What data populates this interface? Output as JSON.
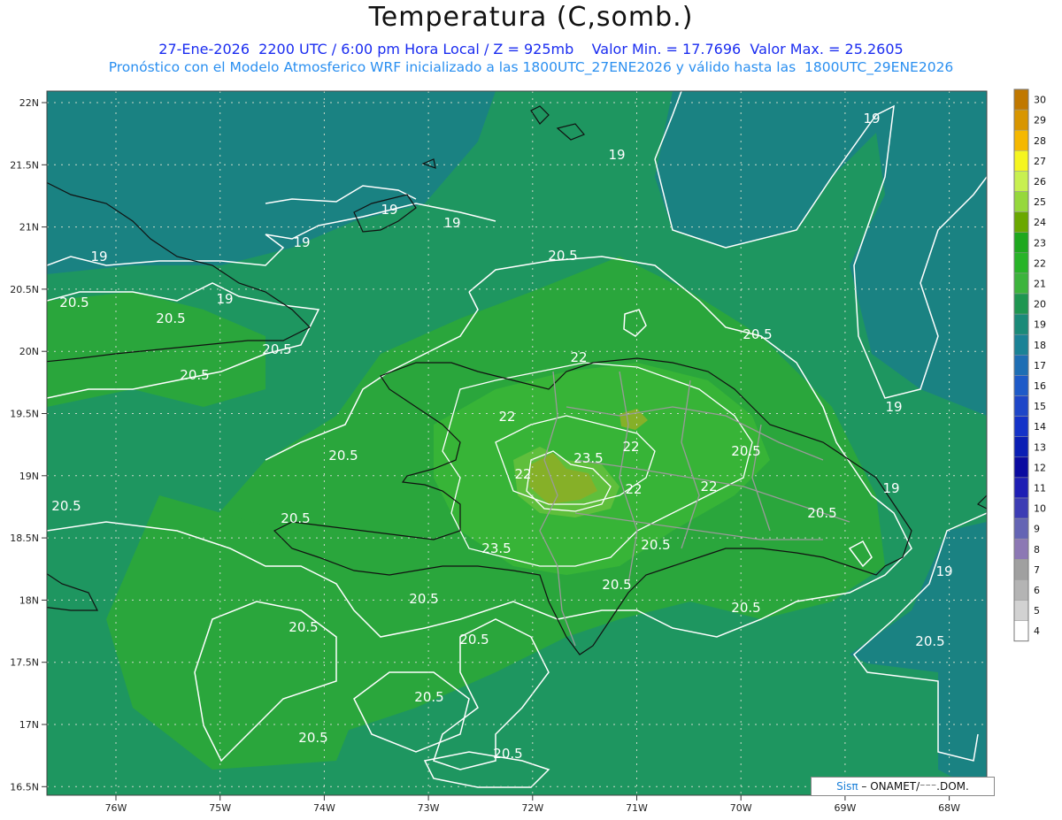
{
  "title": "Temperatura (C,somb.)",
  "subtitle_line1": "27-Ene-2026  2200 UTC / 6:00 pm Hora Local / Z = 925mb    Valor Min. = 17.7696  Valor Max. = 25.2605",
  "subtitle_line2": "Pronóstico con el Modelo Atmosferico WRF inicializado a las 1800UTC_27ENE2026 y válido hasta las  1800UTC_29ENE2026",
  "lat_labels": [
    "22N",
    "21.5N",
    "21N",
    "20.5N",
    "20N",
    "19.5N",
    "19N",
    "18.5N",
    "18N",
    "17.5N",
    "17N",
    "16.5N"
  ],
  "lat_values": [
    22,
    21.5,
    21,
    20.5,
    20,
    19.5,
    19,
    18.5,
    18,
    17.5,
    17,
    16.5
  ],
  "lon_labels": [
    "76W",
    "75W",
    "74W",
    "73W",
    "72W",
    "71W",
    "70W",
    "69W",
    "68W"
  ],
  "lon_values": [
    -76,
    -75,
    -74,
    -73,
    -72,
    -71,
    -70,
    -69,
    -68
  ],
  "colorbar": {
    "levels": [
      "30",
      "29",
      "28",
      "27",
      "26",
      "25",
      "24",
      "23",
      "22",
      "21",
      "20",
      "19",
      "18",
      "17",
      "16",
      "15",
      "14",
      "13",
      "12",
      "11",
      "10",
      "9",
      "8",
      "7",
      "6",
      "5",
      "4"
    ],
    "colors": [
      "#c07800",
      "#d89600",
      "#f5b800",
      "#f5f520",
      "#c8f050",
      "#96d83c",
      "#6aa800",
      "#1ea81e",
      "#28b428",
      "#3cb43c",
      "#1e9650",
      "#1a8a78",
      "#1a8296",
      "#1e6eb4",
      "#1e5ac8",
      "#1e46c8",
      "#1432c8",
      "#0a1eb4",
      "#0a0aa0",
      "#1e1eb4",
      "#3c3cb4",
      "#6464b4",
      "#8c78b4",
      "#a0a0a0",
      "#b4b4b4",
      "#d2d2d2",
      "#ffffff"
    ]
  },
  "contour_labels": [
    "19",
    "19",
    "19",
    "19",
    "19",
    "19",
    "19",
    "19",
    "19",
    "19",
    "20.5",
    "20.5",
    "20.5",
    "20.5",
    "20.5",
    "20.5",
    "20.5",
    "20.5",
    "20.5",
    "20.5",
    "20.5",
    "20.5",
    "20.5",
    "20.5",
    "20.5",
    "20.5",
    "20.5",
    "20.5",
    "20.5",
    "20.5",
    "20.5",
    "22",
    "22",
    "22",
    "22",
    "22",
    "22",
    "23.5",
    "23.5"
  ],
  "credit": {
    "prefix": "Sisπ",
    "text": "– ONAMET/⁻⁻⁻.DOM."
  }
}
